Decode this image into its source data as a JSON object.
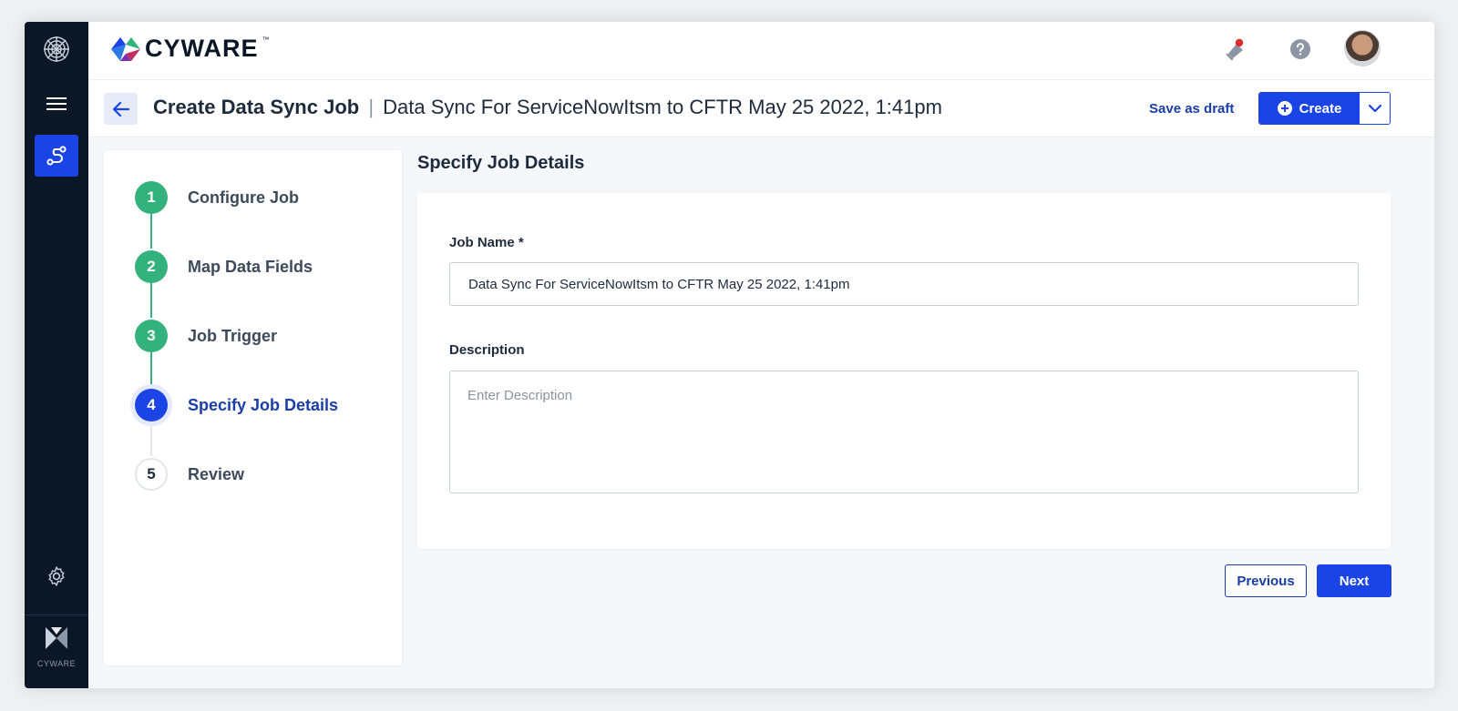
{
  "brand": {
    "name": "CYWARE",
    "tm": "™",
    "mini_label": "CYWARE"
  },
  "rail": {
    "icons": [
      "app-logo-icon",
      "menu-icon",
      "route-icon",
      "gear-icon",
      "cyware-mark-icon"
    ]
  },
  "topbar": {
    "icons": [
      "notification-bell-icon",
      "help-icon",
      "user-avatar"
    ]
  },
  "header": {
    "title_main": "Create Data Sync Job",
    "separator": "|",
    "title_sub": "Data Sync For ServiceNowItsm to CFTR May 25 2022, 1:41pm",
    "save_draft_label": "Save as draft",
    "create_label": "Create"
  },
  "stepper": {
    "steps": [
      {
        "number": "1",
        "label": "Configure Job",
        "state": "done"
      },
      {
        "number": "2",
        "label": "Map Data Fields",
        "state": "done"
      },
      {
        "number": "3",
        "label": "Job Trigger",
        "state": "done"
      },
      {
        "number": "4",
        "label": "Specify Job Details",
        "state": "active"
      },
      {
        "number": "5",
        "label": "Review",
        "state": "pending"
      }
    ]
  },
  "form": {
    "section_title": "Specify Job Details",
    "job_name_label": "Job Name *",
    "job_name_value": "Data Sync For ServiceNowItsm to CFTR May 25 2022, 1:41pm",
    "description_label": "Description",
    "description_placeholder": "Enter Description"
  },
  "footer": {
    "previous_label": "Previous",
    "next_label": "Next"
  },
  "colors": {
    "primary": "#1b44e6",
    "success": "#34b27d",
    "rail": "#0b1627",
    "link": "#1a3ea8"
  }
}
